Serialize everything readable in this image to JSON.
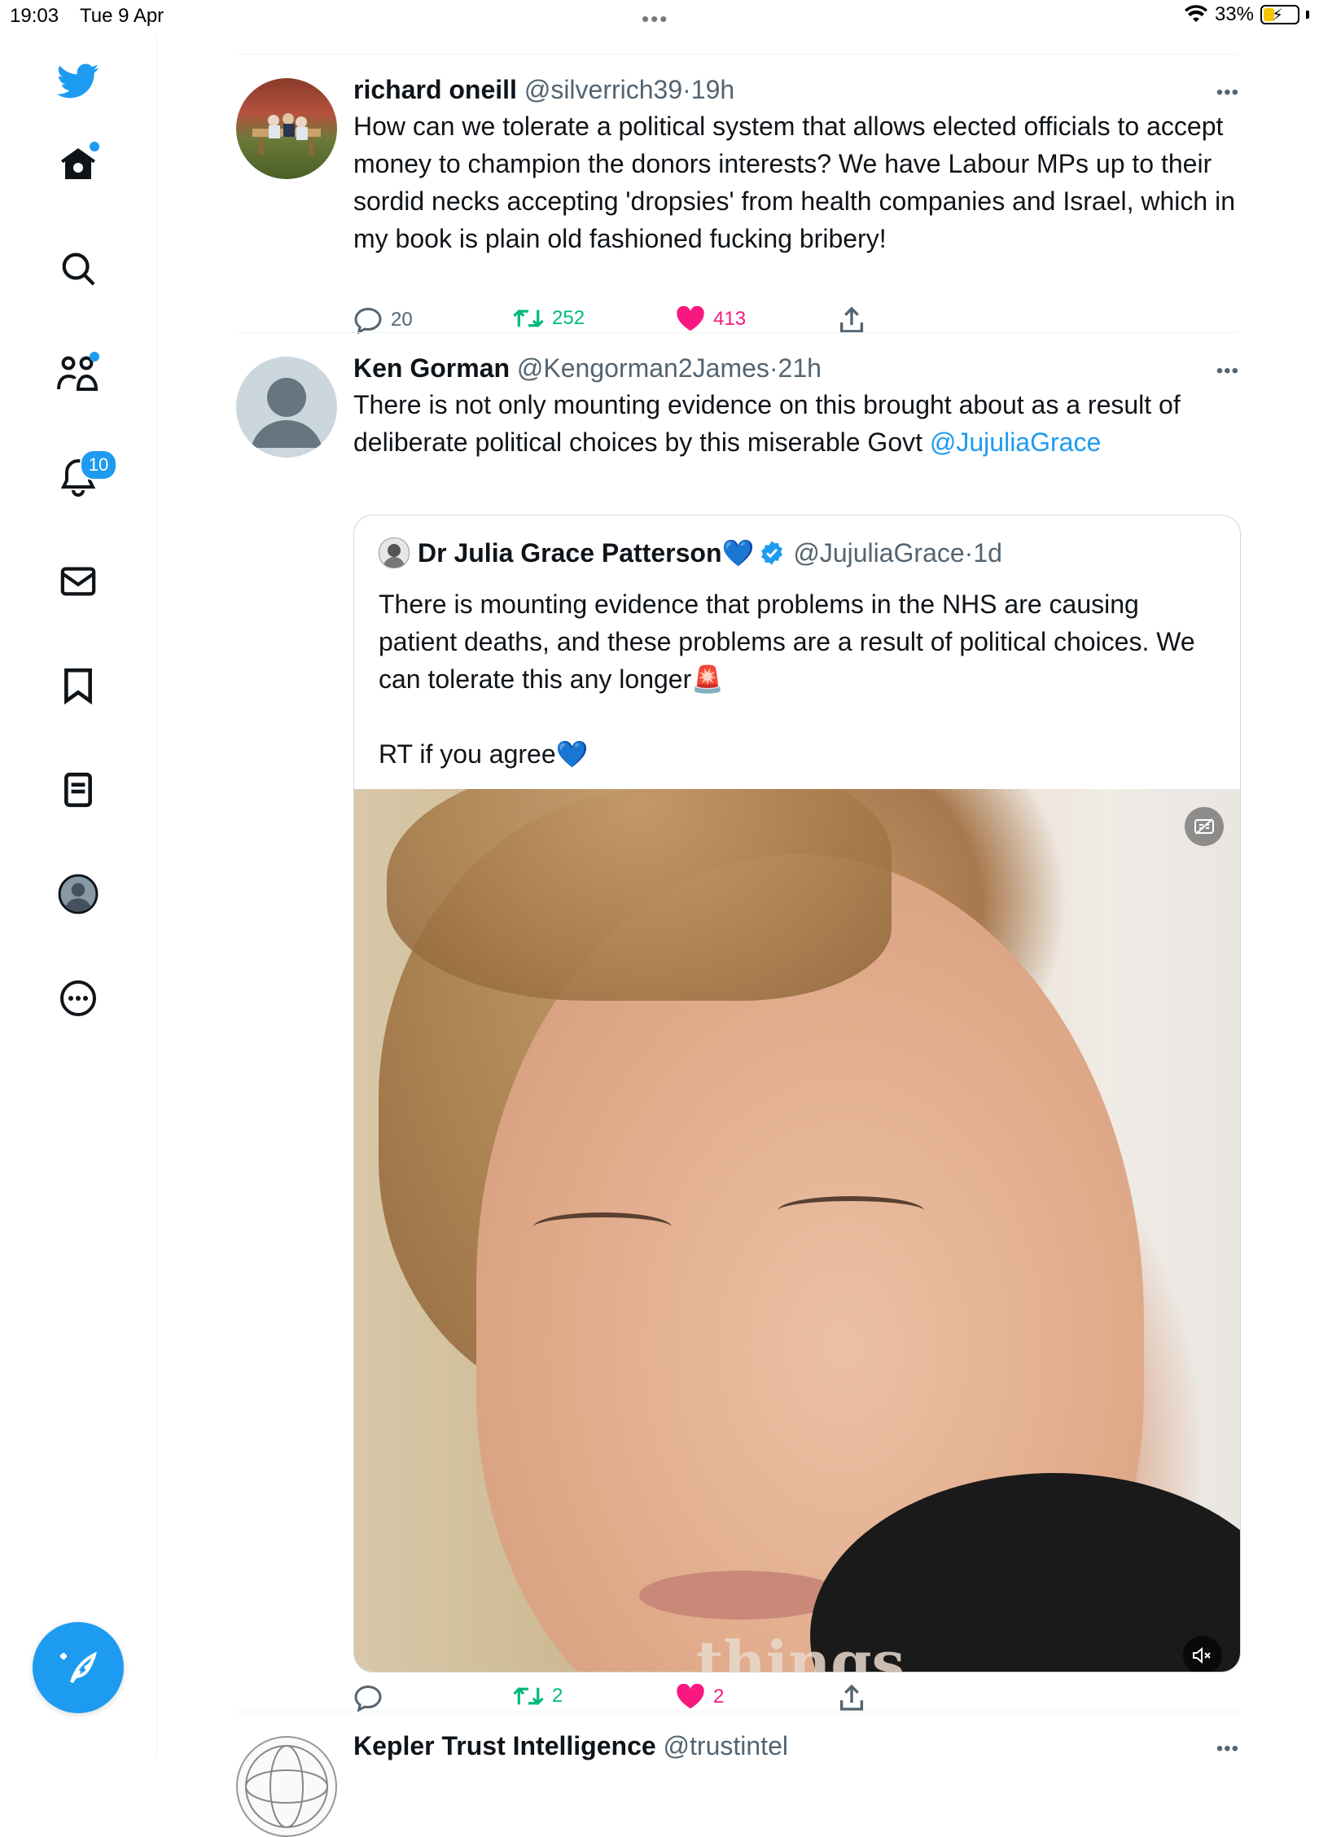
{
  "status_bar": {
    "time": "19:03",
    "date": "Tue 9 Apr",
    "battery": "33%"
  },
  "colors": {
    "accent": "#1d9bf0",
    "retweet": "#00ba7c",
    "like": "#f91880",
    "text": "#0f1419",
    "muted": "#536471"
  },
  "sidebar": {
    "items": [
      {
        "icon": "twitter-logo-icon"
      },
      {
        "icon": "home-icon"
      },
      {
        "icon": "search-icon"
      },
      {
        "icon": "communities-icon"
      },
      {
        "icon": "notifications-icon",
        "badge": "10"
      },
      {
        "icon": "messages-icon"
      },
      {
        "icon": "bookmarks-icon"
      },
      {
        "icon": "lists-icon"
      },
      {
        "icon": "profile-icon"
      },
      {
        "icon": "more-icon"
      }
    ],
    "compose_icon": "compose-tweet-icon"
  },
  "tweets": [
    {
      "name": "richard oneill",
      "handle": "@silverrich39",
      "sep": "·",
      "time": "19h",
      "text": "How can we tolerate a political system that allows elected officials to accept money to champion the donors interests? We have Labour MPs up to their sordid necks accepting 'dropsies' from health companies and Israel, which in my book is plain old fashioned fucking bribery!",
      "replies": "20",
      "retweets": "252",
      "likes": "413"
    },
    {
      "name": "Ken Gorman",
      "handle": "@Kengorman2James",
      "sep": "·",
      "time": "21h",
      "text": "There is not only mounting evidence on this brought about as a result of deliberate political choices by this miserable Govt ",
      "mention": "@JujuliaGrace",
      "quote": {
        "name": "Dr Julia Grace Patterson💙",
        "handle": "@JujuliaGrace",
        "sep": "·",
        "time": "1d",
        "text_line1": "There is mounting evidence that problems in the NHS are causing patient deaths, and these problems are a result of political choices. We can tolerate this any longer🚨",
        "text_line2": "RT if you agree💙",
        "video_caption": "things"
      },
      "replies": "",
      "retweets": "2",
      "likes": "2"
    },
    {
      "name": "Kepler Trust Intelligence",
      "handle": "@trustintel"
    }
  ],
  "more_label": "•••"
}
